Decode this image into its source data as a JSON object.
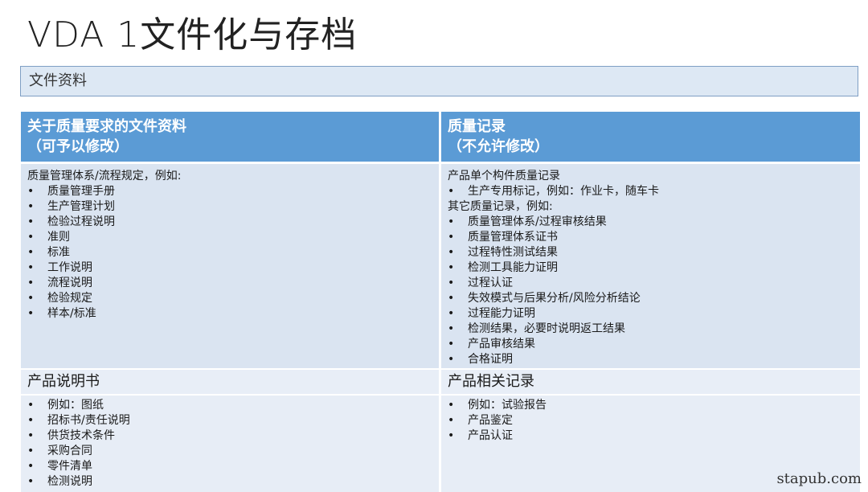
{
  "title": "VDA 1文件化与存档",
  "banner": "文件资料",
  "col_left": {
    "header_line1": "关于质量要求的文件资料",
    "header_line2": "（可予以修改）",
    "intro": "质量管理体系/流程规定，例如:",
    "items": [
      "质量管理手册",
      "生产管理计划",
      "检验过程说明",
      "准则",
      "标准",
      "工作说明",
      "流程说明",
      "检验规定",
      "样本/标准"
    ],
    "sub_title": "产品说明书",
    "sub_items": [
      "例如：图纸",
      "招标书/责任说明",
      "供货技术条件",
      "采购合同",
      "零件清单",
      "检测说明"
    ]
  },
  "col_right": {
    "header_line1": "质量记录",
    "header_line2": "（不允许修改）",
    "intro": "产品单个构件质量记录",
    "intro_items": [
      "生产专用标记，例如：作业卡，随车卡"
    ],
    "intro2": "其它质量记录，例如:",
    "items": [
      "质量管理体系/过程审核结果",
      "质量管理体系证书",
      "过程特性测试结果",
      "检测工具能力证明",
      "过程认证",
      "失效模式与后果分析/风险分析结论",
      "过程能力证明",
      "检测结果，必要时说明返工结果",
      "产品审核结果",
      "合格证明"
    ],
    "sub_title": "产品相关记录",
    "sub_items": [
      "例如：试验报告",
      "产品鉴定",
      "产品认证"
    ]
  },
  "bullet_symbol": "•",
  "watermark": "stapub.com"
}
